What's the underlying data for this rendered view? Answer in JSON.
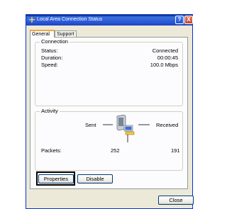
{
  "window": {
    "title": "Local Area Connection Status",
    "help_label": "?",
    "close_label": "X"
  },
  "tabs": [
    {
      "label": "General",
      "selected": true
    },
    {
      "label": "Support",
      "selected": false
    }
  ],
  "connection": {
    "title": "Connection",
    "rows": [
      {
        "label": "Status:",
        "value": "Connected"
      },
      {
        "label": "Duration:",
        "value": "00:00:45"
      },
      {
        "label": "Speed:",
        "value": "100.0 Mbps"
      }
    ]
  },
  "activity": {
    "title": "Activity",
    "sent_label": "Sent",
    "received_label": "Received",
    "packets_label": "Packets:",
    "packets_sent": "252",
    "packets_received": "191",
    "icon": "network-computers-icon"
  },
  "buttons": {
    "properties": "Properties",
    "disable": "Disable",
    "close": "Close"
  },
  "colors": {
    "titlebar": "#2a58d6",
    "dialog_bg": "#ece9d8",
    "highlight": "#000000"
  }
}
